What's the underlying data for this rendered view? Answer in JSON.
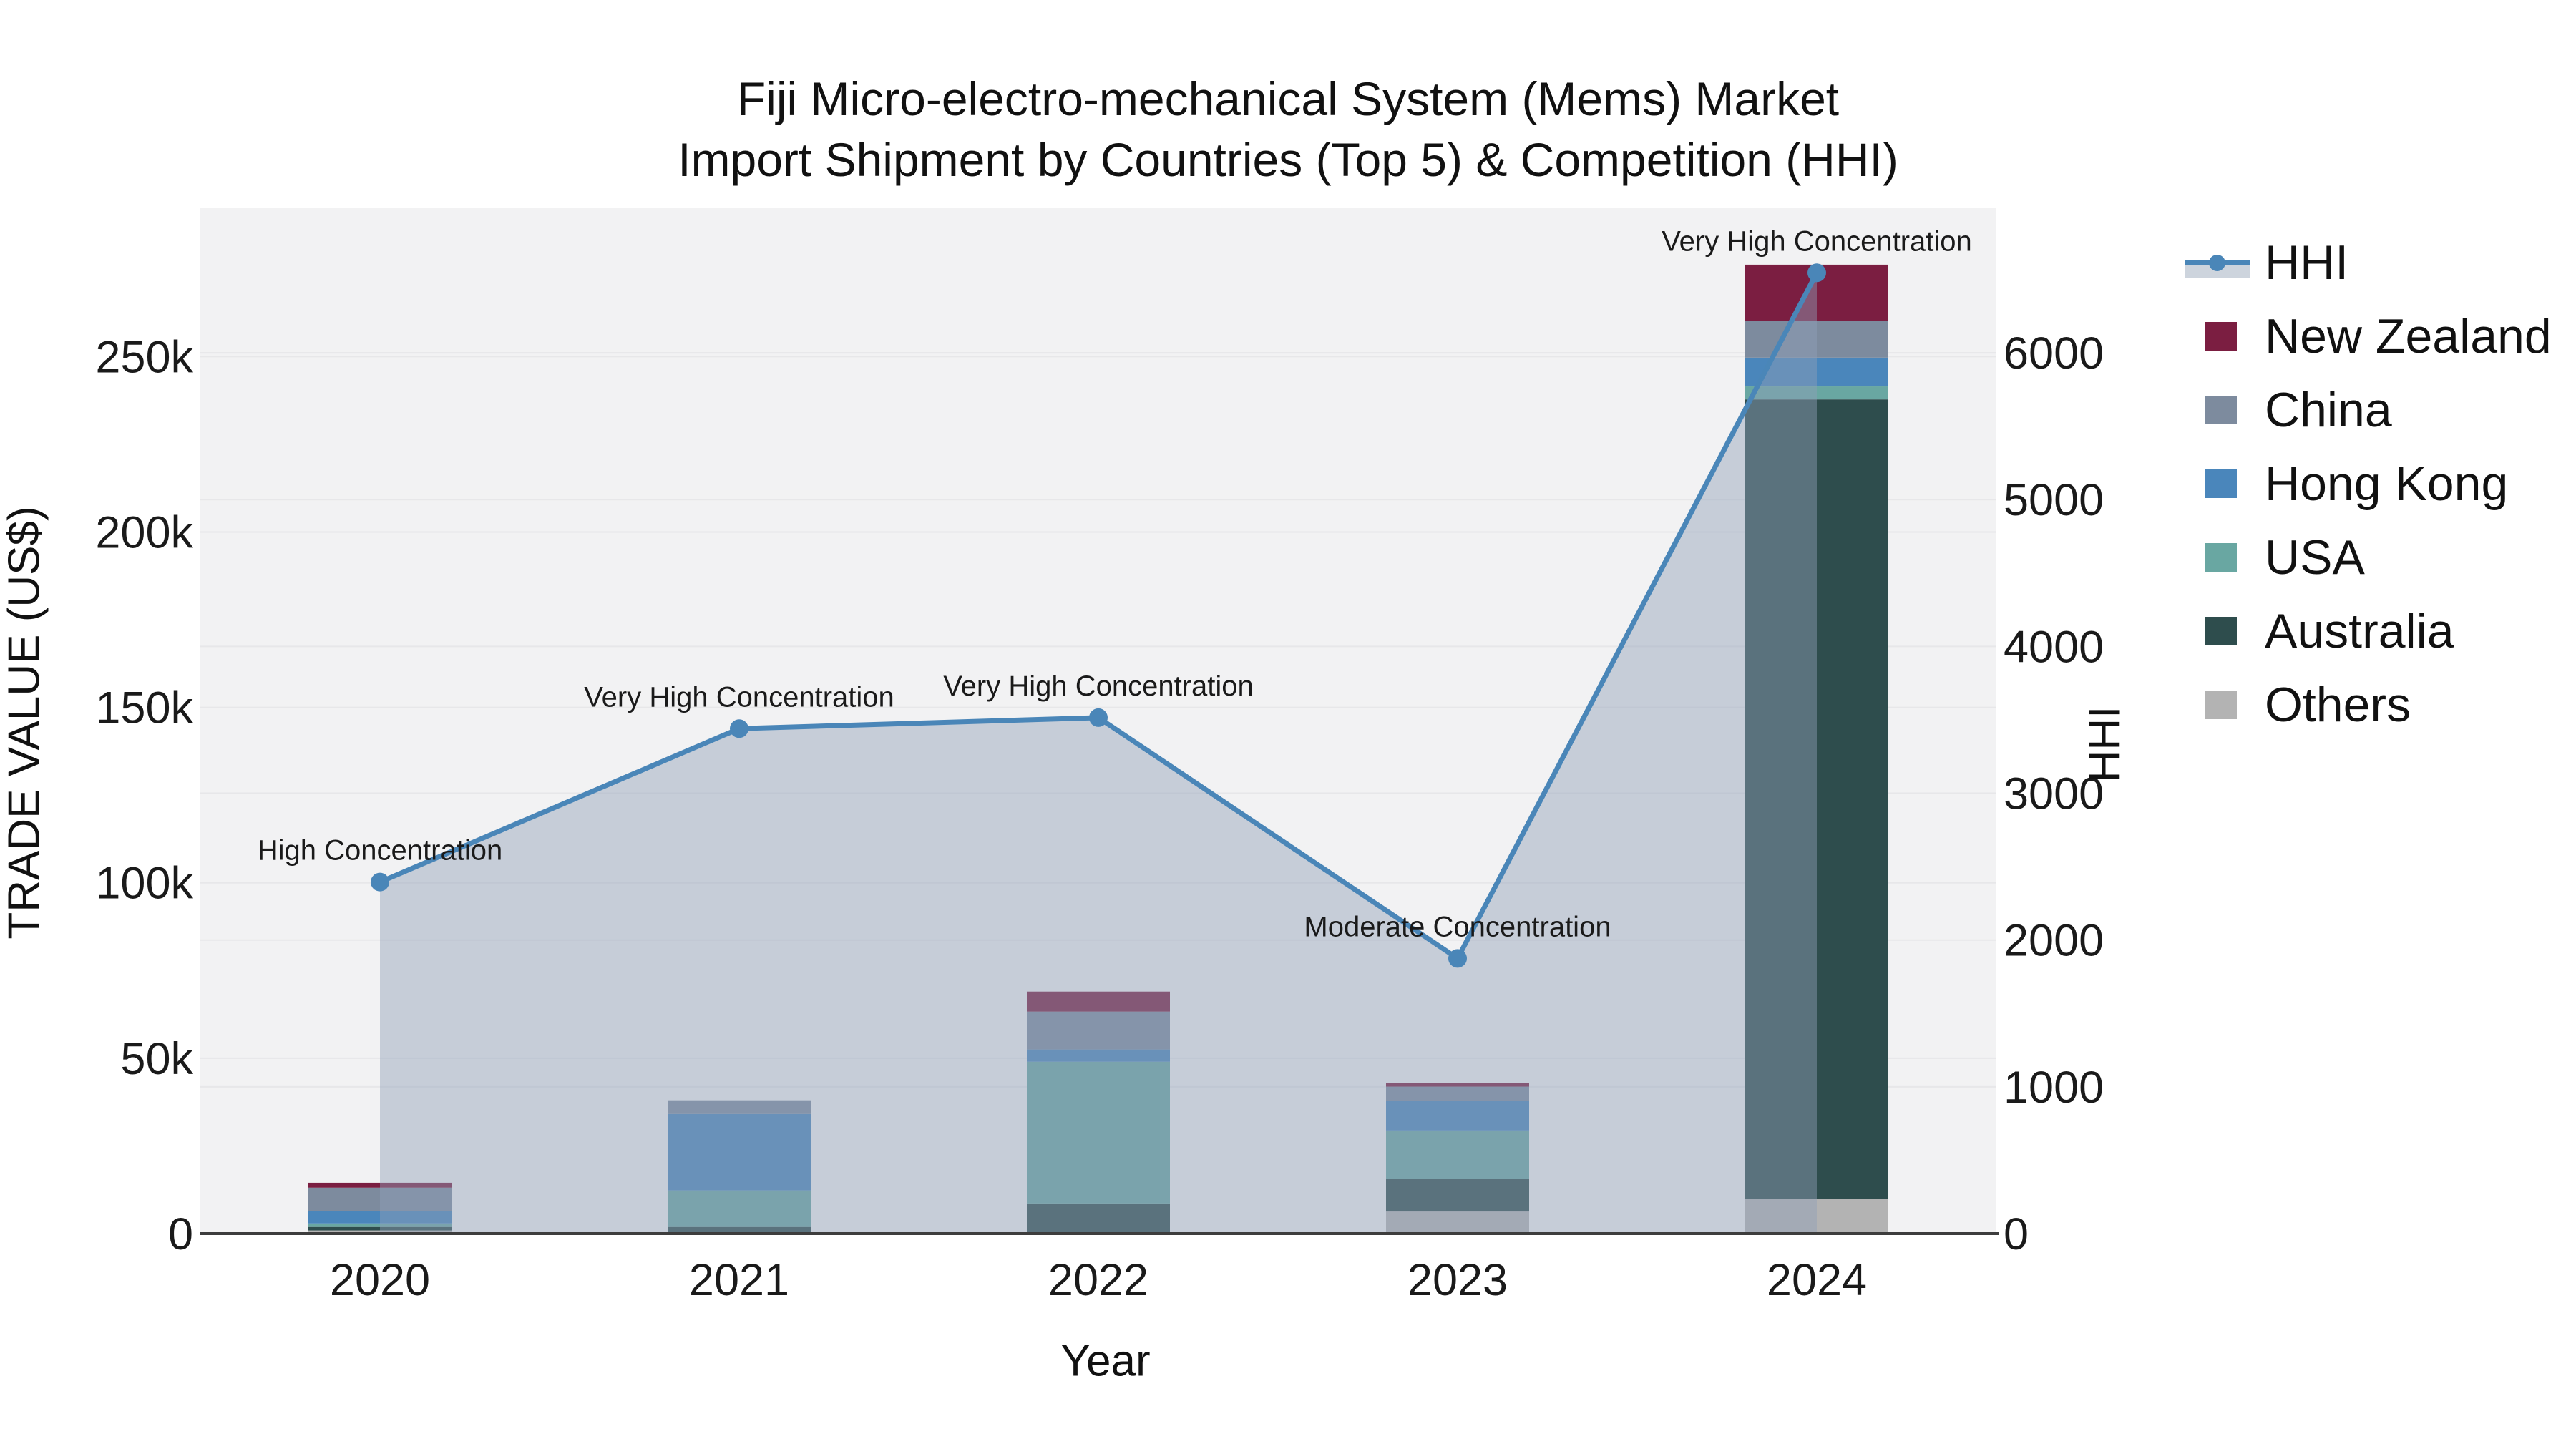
{
  "title": {
    "line1": "Fiji Micro-electro-mechanical System (Mems) Market",
    "line2": "Import Shipment by Countries (Top 5) & Competition (HHI)"
  },
  "legend": {
    "items": [
      {
        "label": "HHI",
        "type": "line",
        "color": "#4a86b8",
        "fill": "#cdd4dd"
      },
      {
        "label": "New Zealand",
        "type": "swatch",
        "color": "#7b1e41"
      },
      {
        "label": "China",
        "type": "swatch",
        "color": "#7d8b9e"
      },
      {
        "label": "Hong Kong",
        "type": "swatch",
        "color": "#4a86bb"
      },
      {
        "label": "USA",
        "type": "swatch",
        "color": "#69a7a2"
      },
      {
        "label": "Australia",
        "type": "swatch",
        "color": "#2e4d4d"
      },
      {
        "label": "Others",
        "type": "swatch",
        "color": "#b3b3b3"
      }
    ]
  },
  "chart_data": {
    "type": "bar+line",
    "categories": [
      "2020",
      "2021",
      "2022",
      "2023",
      "2024"
    ],
    "xlabel": "Year",
    "bar_value_unit": "US$",
    "stack_order": "bottom to top",
    "series": [
      {
        "name": "Others",
        "color": "#b3b3b3",
        "values": [
          900,
          0,
          0,
          6300,
          9800
        ]
      },
      {
        "name": "Australia",
        "color": "#2e4d4d",
        "values": [
          1000,
          1900,
          8600,
          9400,
          228000
        ]
      },
      {
        "name": "USA",
        "color": "#69a7a2",
        "values": [
          1000,
          10400,
          40400,
          13700,
          3700
        ]
      },
      {
        "name": "Hong Kong",
        "color": "#4a86bb",
        "values": [
          3500,
          21800,
          3500,
          8400,
          8200
        ]
      },
      {
        "name": "China",
        "color": "#7d8b9e",
        "values": [
          6700,
          3900,
          10800,
          4100,
          10400
        ]
      },
      {
        "name": "New Zealand",
        "color": "#7b1e41",
        "values": [
          1400,
          0,
          5700,
          1000,
          16100
        ]
      }
    ],
    "bar_totals": [
      14500,
      38000,
      69000,
      42900,
      276200
    ],
    "hhi_line": {
      "name": "HHI",
      "color": "#4a86b8",
      "area_fill": "rgba(145,160,183,0.45)",
      "values": [
        2395,
        3440,
        3515,
        1875,
        6545
      ]
    },
    "annotations": [
      {
        "category": "2020",
        "text": "High Concentration"
      },
      {
        "category": "2021",
        "text": "Very High Concentration"
      },
      {
        "category": "2022",
        "text": "Very High Concentration"
      },
      {
        "category": "2023",
        "text": "Moderate Concentration"
      },
      {
        "category": "2024",
        "text": "Very High Concentration"
      }
    ],
    "axis_left": {
      "title": "TRADE VALUE (US$)",
      "max": 292500,
      "ticks": [
        {
          "v": 0,
          "label": "0"
        },
        {
          "v": 50000,
          "label": "50k"
        },
        {
          "v": 100000,
          "label": "100k"
        },
        {
          "v": 150000,
          "label": "150k"
        },
        {
          "v": 200000,
          "label": "200k"
        },
        {
          "v": 250000,
          "label": "250k"
        }
      ]
    },
    "axis_right": {
      "title": "HHI",
      "max": 6990,
      "ticks": [
        {
          "v": 0,
          "label": "0"
        },
        {
          "v": 1000,
          "label": "1000"
        },
        {
          "v": 2000,
          "label": "2000"
        },
        {
          "v": 3000,
          "label": "3000"
        },
        {
          "v": 4000,
          "label": "4000"
        },
        {
          "v": 5000,
          "label": "5000"
        },
        {
          "v": 6000,
          "label": "6000"
        }
      ]
    },
    "style": {
      "plot_bg": "#f2f2f3",
      "grid_color": "#e7e7e9",
      "axis_line_color": "#3d3d3d"
    }
  }
}
